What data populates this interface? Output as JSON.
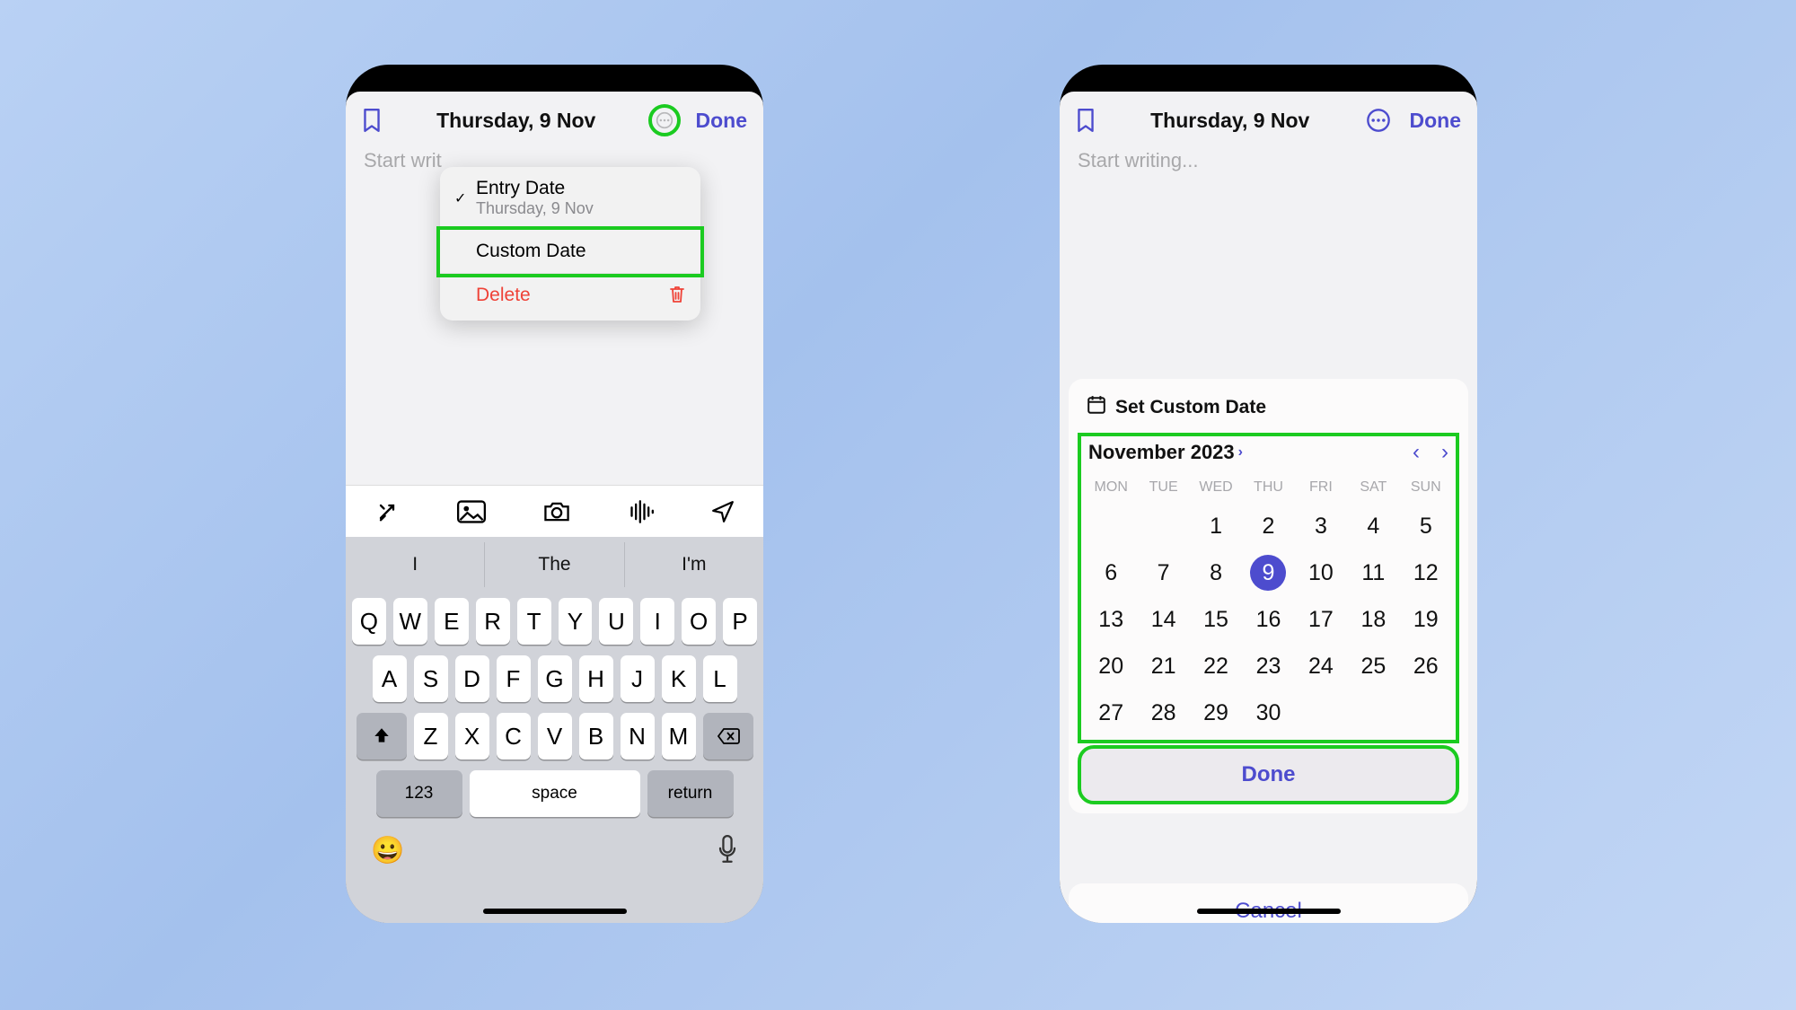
{
  "header": {
    "title": "Thursday, 9 Nov",
    "done": "Done"
  },
  "editor": {
    "placeholder": "Start writing...",
    "placeholder_cut": "Start writ"
  },
  "menu": {
    "entry_date": {
      "label": "Entry Date",
      "sub": "Thursday, 9 Nov"
    },
    "custom_date": "Custom Date",
    "delete": "Delete"
  },
  "suggestions": [
    "I",
    "The",
    "I'm"
  ],
  "kb": {
    "row1": [
      "Q",
      "W",
      "E",
      "R",
      "T",
      "Y",
      "U",
      "I",
      "O",
      "P"
    ],
    "row2": [
      "A",
      "S",
      "D",
      "F",
      "G",
      "H",
      "J",
      "K",
      "L"
    ],
    "row3": [
      "Z",
      "X",
      "C",
      "V",
      "B",
      "N",
      "M"
    ],
    "num": "123",
    "space": "space",
    "ret": "return"
  },
  "datepicker": {
    "title": "Set Custom Date",
    "month": "November 2023",
    "weekdays": [
      "MON",
      "TUE",
      "WED",
      "THU",
      "FRI",
      "SAT",
      "SUN"
    ],
    "offset": 2,
    "days": 30,
    "selected": 9,
    "done": "Done",
    "cancel": "Cancel"
  }
}
